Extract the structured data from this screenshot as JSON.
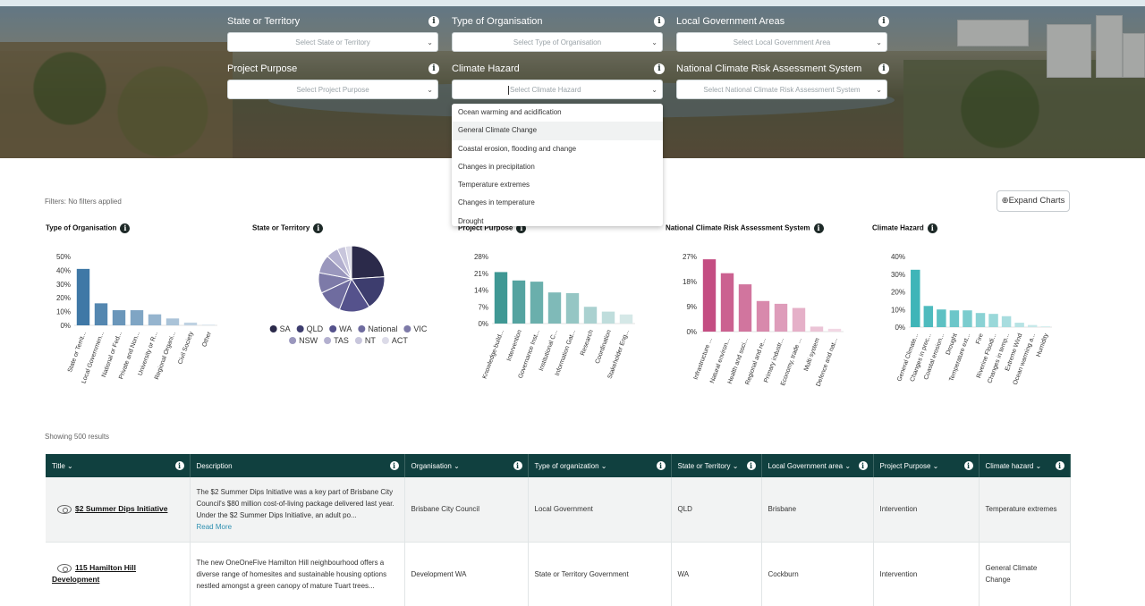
{
  "filters": {
    "state": {
      "label": "State or Territory",
      "placeholder": "Select State or Territory"
    },
    "org_type": {
      "label": "Type of Organisation",
      "placeholder": "Select Type of Organisation"
    },
    "lga": {
      "label": "Local Government Areas",
      "placeholder": "Select Local Government Area"
    },
    "purpose": {
      "label": "Project Purpose",
      "placeholder": "Select Project Purpose"
    },
    "hazard": {
      "label": "Climate Hazard",
      "placeholder": "Select Climate Hazard"
    },
    "ncras": {
      "label": "National Climate Risk Assessment System",
      "placeholder": "Select National Climate Risk Assessment System"
    }
  },
  "hazard_dropdown": {
    "options": [
      "Ocean warming and acidification",
      "General Climate Change",
      "Coastal erosion, flooding and change",
      "Changes in precipitation",
      "Temperature extremes",
      "Changes in temperature",
      "Drought"
    ],
    "highlighted_index": 1
  },
  "status": {
    "filters_applied": "Filters: No filters applied",
    "results": "Showing 500 results"
  },
  "expand_button": "Expand Charts",
  "chart_data": [
    {
      "type": "bar",
      "title": "Type of Organisation",
      "color": "#3f78a6",
      "categories": [
        "State or Territ...",
        "Local Governmen...",
        "National or Fed...",
        "Private and Non...",
        "University or R...",
        "Regional Organi...",
        "Civil Society",
        "Other"
      ],
      "values": [
        41,
        16,
        11,
        11,
        8,
        5,
        2,
        0.5
      ],
      "yticks": [
        "50%",
        "40%",
        "30%",
        "20%",
        "10%",
        "0%"
      ],
      "ylim": [
        0,
        50
      ]
    },
    {
      "type": "pie",
      "title": "State or Territory",
      "categories": [
        "SA",
        "QLD",
        "WA",
        "National",
        "VIC",
        "NSW",
        "TAS",
        "NT",
        "ACT"
      ],
      "values": [
        24,
        17,
        15,
        12,
        10,
        9,
        6,
        4,
        3
      ],
      "colors": [
        "#2b2a4a",
        "#3d3d6e",
        "#55528c",
        "#6f6c9f",
        "#7d7aa8",
        "#9a97bd",
        "#b3b0cf",
        "#c8c6dc",
        "#dcdbe8"
      ]
    },
    {
      "type": "bar",
      "title": "Project Purpose",
      "color": "#3f9894",
      "categories": [
        "Knowledge-build...",
        "Intervention",
        "Governance Inst...",
        "Institutional C...",
        "Information Gat...",
        "Research",
        "Coordination",
        "Stakeholder Eng..."
      ],
      "values": [
        21.5,
        18,
        17.5,
        13,
        12.7,
        7,
        5,
        3.8
      ],
      "yticks": [
        "28%",
        "21%",
        "14%",
        "7%",
        "0%"
      ],
      "ylim": [
        0,
        28
      ]
    },
    {
      "type": "bar",
      "title": "National Climate Risk Assessment System",
      "color": "#c44d82",
      "categories": [
        "Infrastructure ...",
        "Natural environ...",
        "Health and soci...",
        "Regional and re...",
        "Primary industr...",
        "Economy, trade ...",
        "Multi system",
        "Defence and nat..."
      ],
      "values": [
        26,
        21,
        17,
        11,
        10,
        8.5,
        1.8,
        1
      ],
      "yticks": [
        "27%",
        "18%",
        "9%",
        "0%"
      ],
      "ylim": [
        0,
        27
      ]
    },
    {
      "type": "bar",
      "title": "Climate Hazard",
      "color": "#3fb5b8",
      "categories": [
        "General Climate...",
        "Changes in prec...",
        "Coastal erosion...",
        "Drought",
        "Temperature ext...",
        "Fire",
        "Riverine Floodi...",
        "Changes in temp...",
        "Extreme Wind",
        "Ocean warming a...",
        "Humidity"
      ],
      "values": [
        32.5,
        12,
        10,
        9.5,
        9.5,
        8,
        7.5,
        6.2,
        2.5,
        1.2,
        0.5
      ],
      "yticks": [
        "40%",
        "30%",
        "20%",
        "10%",
        "0%"
      ],
      "ylim": [
        0,
        40
      ]
    }
  ],
  "table": {
    "headers": {
      "title": "Title",
      "description": "Description",
      "organisation": "Organisation",
      "org_type": "Type of organization",
      "state": "State or Territory",
      "lga": "Local Government area",
      "purpose": "Project Purpose",
      "hazard": "Climate hazard"
    },
    "rows": [
      {
        "title": "$2 Summer Dips Initiative",
        "description": "The $2 Summer Dips Initiative was a key part of Brisbane City Council's $80 million cost-of-living package delivered last year. Under the $2 Summer Dips Initiative, an adult po...",
        "read_more": "Read More",
        "organisation": "Brisbane City Council",
        "org_type": "Local Government",
        "state": "QLD",
        "lga": "Brisbane",
        "purpose": "Intervention",
        "hazard": "Temperature extremes"
      },
      {
        "title": "115 Hamilton Hill Development",
        "description": "The new OneOneFive Hamilton Hill neighbourhood offers a diverse range of homesites and sustainable housing options nestled amongst a green canopy of mature Tuart trees...",
        "organisation": "Development WA",
        "org_type": "State or Territory Government",
        "state": "WA",
        "lga": "Cockburn",
        "purpose": "Intervention",
        "hazard": "General Climate Change"
      }
    ]
  }
}
